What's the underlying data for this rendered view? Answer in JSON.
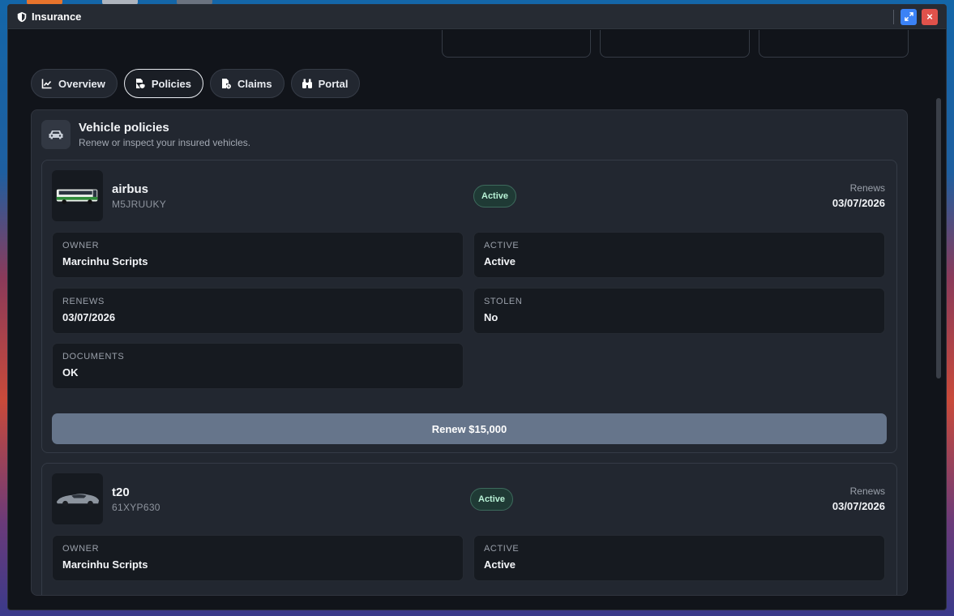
{
  "window": {
    "title": "Insurance",
    "expand_icon": "expand-icon",
    "close_label": "×"
  },
  "tabs": [
    {
      "label": "Overview",
      "icon": "chart-line-icon"
    },
    {
      "label": "Policies",
      "icon": "file-shield-icon",
      "active": true
    },
    {
      "label": "Claims",
      "icon": "file-claims-icon"
    },
    {
      "label": "Portal",
      "icon": "binoculars-icon"
    }
  ],
  "panel": {
    "title": "Vehicle policies",
    "subtitle": "Renew or inspect your insured vehicles.",
    "icon": "car-icon"
  },
  "policies": [
    {
      "name": "airbus",
      "plate": "M5JRUUKY",
      "status": "Active",
      "renews_label": "Renews",
      "renews_date": "03/07/2026",
      "fields": {
        "owner": {
          "label": "OWNER",
          "value": "Marcinhu Scripts"
        },
        "active": {
          "label": "ACTIVE",
          "value": "Active"
        },
        "renews": {
          "label": "RENEWS",
          "value": "03/07/2026"
        },
        "stolen": {
          "label": "STOLEN",
          "value": "No"
        },
        "documents": {
          "label": "DOCUMENTS",
          "value": "OK"
        }
      },
      "renew_button": "Renew $15,000"
    },
    {
      "name": "t20",
      "plate": "61XYP630",
      "status": "Active",
      "renews_label": "Renews",
      "renews_date": "03/07/2026",
      "fields": {
        "owner": {
          "label": "OWNER",
          "value": "Marcinhu Scripts"
        },
        "active": {
          "label": "ACTIVE",
          "value": "Active"
        }
      }
    }
  ],
  "colors": {
    "accent_blue": "#3b82f6",
    "close_red": "#e0524b",
    "badge_green": "#b8f2d6",
    "renew_button": "#66758b"
  }
}
